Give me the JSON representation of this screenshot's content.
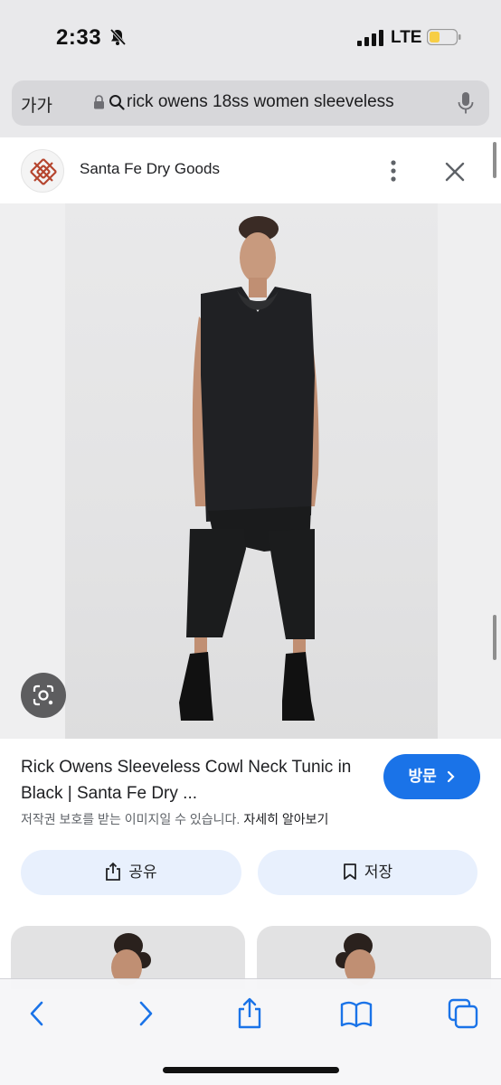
{
  "status_bar": {
    "time": "2:33",
    "network": "LTE",
    "icons": [
      "bell-slash-icon",
      "signal-icon",
      "battery-icon"
    ]
  },
  "browser": {
    "text_size_label": "가가",
    "url_text": "rick owens 18ss women sleeveless",
    "icons": [
      "lock-icon",
      "search-icon",
      "microphone-icon"
    ]
  },
  "source": {
    "site_name": "Santa Fe Dry Goods",
    "icons": [
      "site-logo-icon",
      "more-vertical-icon",
      "close-icon"
    ]
  },
  "result": {
    "title": "Rick Owens Sleeveless Cowl Neck Tunic in Black | Santa Fe Dry ...",
    "visit_label": "방문",
    "copyright_notice": "저작권 보호를 받는 이미지일 수 있습니다.",
    "learn_more": "자세히 알아보기",
    "share_label": "공유",
    "save_label": "저장"
  },
  "toolbar": {
    "icons": [
      "back-icon",
      "forward-icon",
      "share-icon",
      "bookmarks-icon",
      "tabs-icon"
    ]
  },
  "colors": {
    "accent": "#1a73e8",
    "action_bg": "#e8f0fd",
    "chrome_bg": "#e9e9eb",
    "garment": "#202124"
  }
}
